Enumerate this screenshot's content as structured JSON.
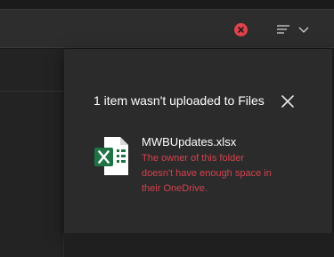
{
  "toolbar": {
    "error_icon": "error-circle-x-icon",
    "sort_icon": "sort-lines-icon",
    "chevron_icon": "chevron-down-icon"
  },
  "flyout": {
    "title": "1 item wasn't uploaded to Files",
    "close_icon": "close-icon",
    "file": {
      "name": "MWBUpdates.xlsx",
      "file_type_icon": "excel-file-icon",
      "error": "The owner of this folder doesn't have enough space in their OneDrive."
    }
  },
  "colors": {
    "background": "#1b1b1b",
    "toolbar": "#2d2d2d",
    "flyout": "#2b2b2b",
    "error_red": "#e0434b",
    "error_text": "#d4424e",
    "excel_green": "#1f7244"
  }
}
